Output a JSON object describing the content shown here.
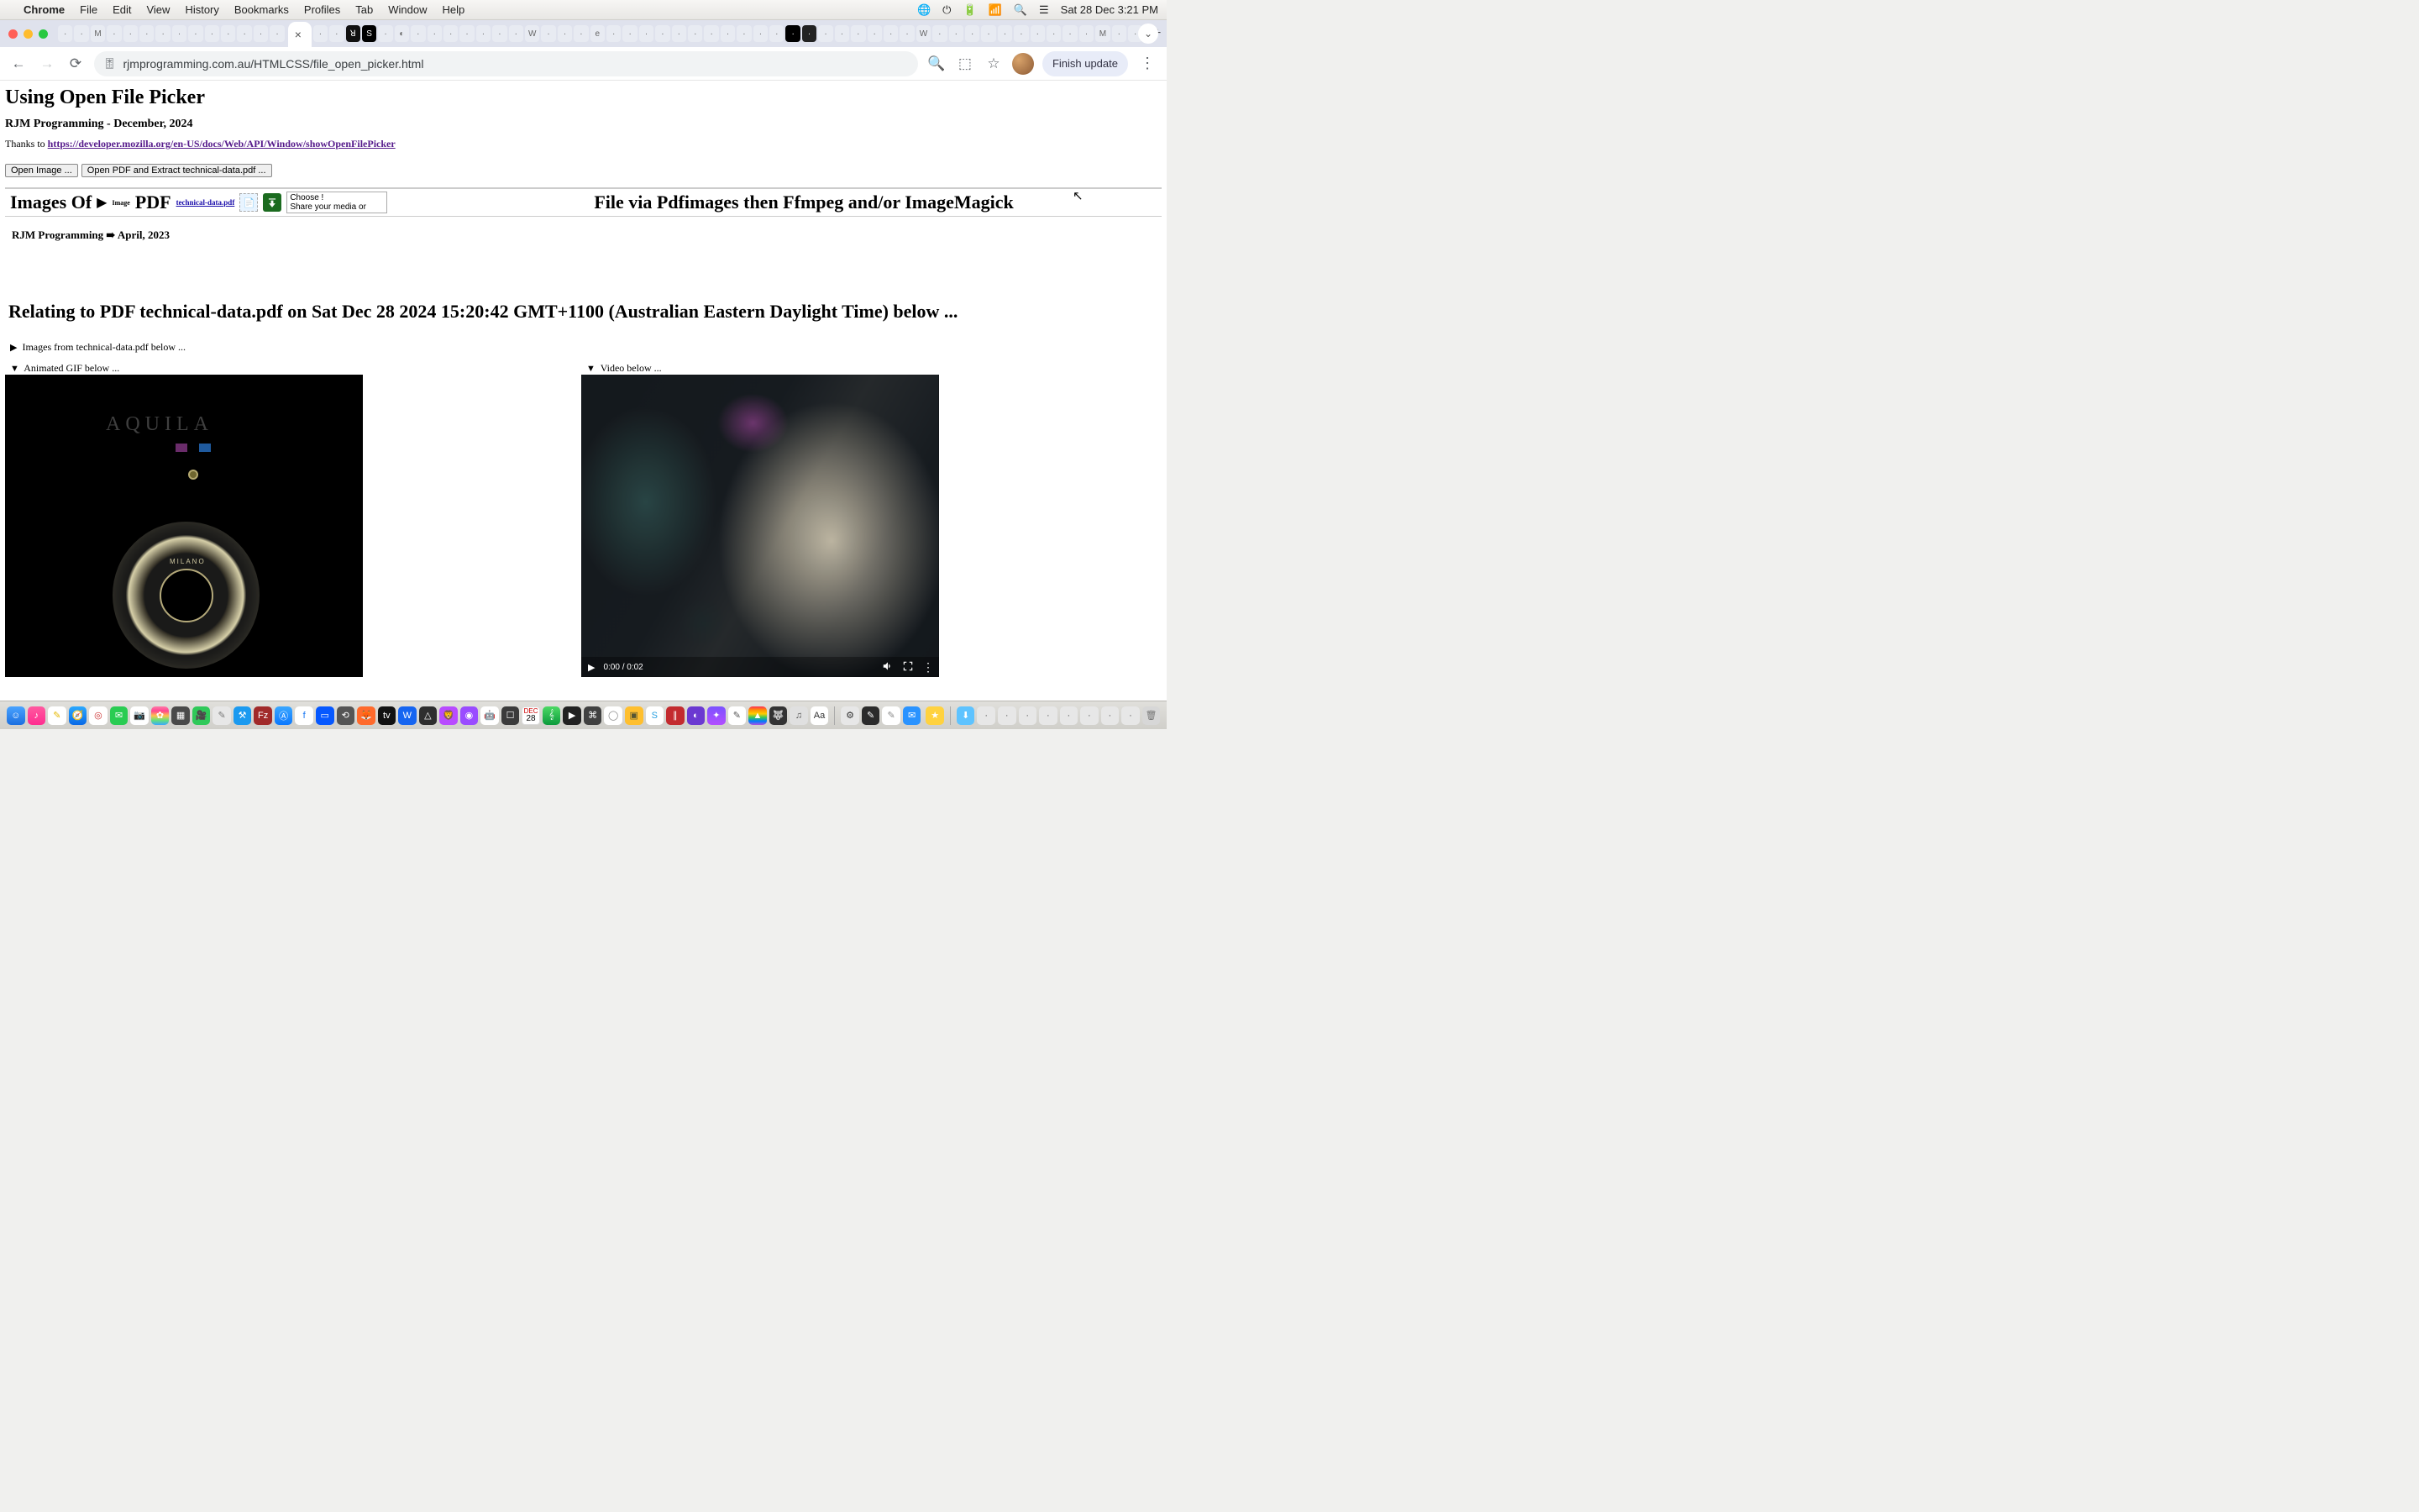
{
  "menubar": {
    "app": "Chrome",
    "items": [
      "File",
      "Edit",
      "View",
      "History",
      "Bookmarks",
      "Profiles",
      "Tab",
      "Window",
      "Help"
    ],
    "clock": "Sat 28 Dec  3:21 PM"
  },
  "chrome": {
    "new_tab": "+",
    "tab_dropdown": "⌄",
    "back_tooltip": "Back",
    "forward_tooltip": "Forward",
    "reload_tooltip": "Reload",
    "url": "rjmprogramming.com.au/HTMLCSS/file_open_picker.html",
    "finish_update": "Finish update"
  },
  "page": {
    "h1": "Using Open File Picker",
    "sub": "RJM Programming - December, 2024",
    "thanks_prefix": "Thanks to ",
    "thanks_link": "https://developer.mozilla.org/en-US/docs/Web/API/Window/showOpenFilePicker",
    "btn_open_image": "Open Image ...",
    "btn_open_pdf": "Open PDF and Extract technical-data.pdf ...",
    "row": {
      "images_of": "Images Of",
      "image": "Image",
      "pdf": "PDF",
      "tdlink": "technical-data.pdf",
      "choose": "Choose !",
      "share": "Share your media or",
      "right": "File via Pdfimages then Ffmpeg and/or ImageMagick"
    },
    "sub2_left": "RJM Programming",
    "sub2_arrow": "➠",
    "sub2_right": "April, 2023",
    "bighead": "Relating to PDF technical-data.pdf on Sat Dec 28 2024 15:20:42 GMT+1100 (Australian Eastern Daylight Time) below ...",
    "details_images": "Images from technical-data.pdf below ...",
    "details_gif": "Animated GIF below ...",
    "details_video": "Video below ...",
    "gif_brand": "AQUILA",
    "gauge_label": "MILANO",
    "video_time": "0:00 / 0:02"
  },
  "dock": {
    "date_top": "DEC",
    "date_num": "28"
  }
}
